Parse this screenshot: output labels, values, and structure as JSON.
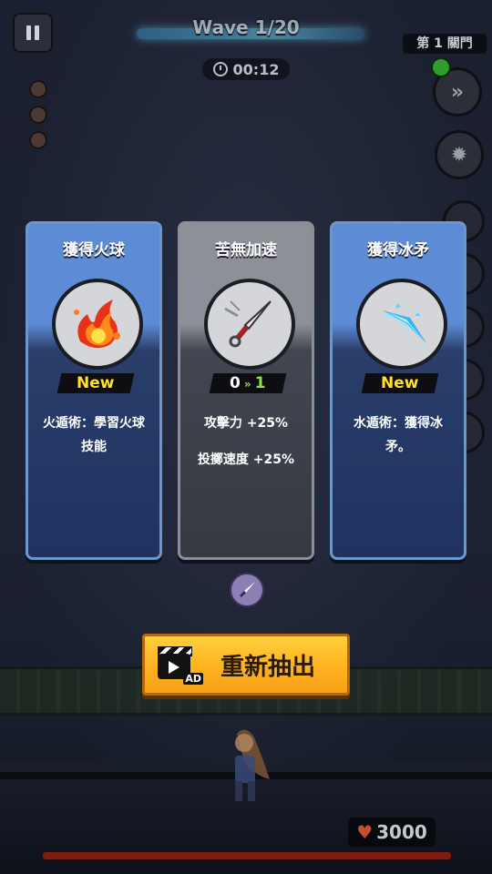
{
  "hud": {
    "wave_text": "Wave 1/20",
    "timer": "00:12",
    "gate_label": "第 1 關門",
    "hp_value": "3000"
  },
  "cards": [
    {
      "title": "獲得火球",
      "tag": "New",
      "desc": [
        "火遁術：學習火球技能"
      ],
      "icon": "fireball-icon"
    },
    {
      "title": "苦無加速",
      "level_from": "0",
      "level_to": "1",
      "desc": [
        "攻擊力 +25%",
        "投擲速度 +25%"
      ],
      "icon": "kunai-icon"
    },
    {
      "title": "獲得冰矛",
      "tag": "New",
      "desc": [
        "水遁術：獲得冰矛。"
      ],
      "icon": "ice-spear-icon"
    }
  ],
  "reroll": {
    "label": "重新抽出",
    "ad_badge": "AD"
  },
  "colors": {
    "card_blue": "#5d8bd6",
    "card_gray": "#8d9097",
    "reroll_orange": "#ffb220",
    "tag_new": "#ffe02a"
  }
}
